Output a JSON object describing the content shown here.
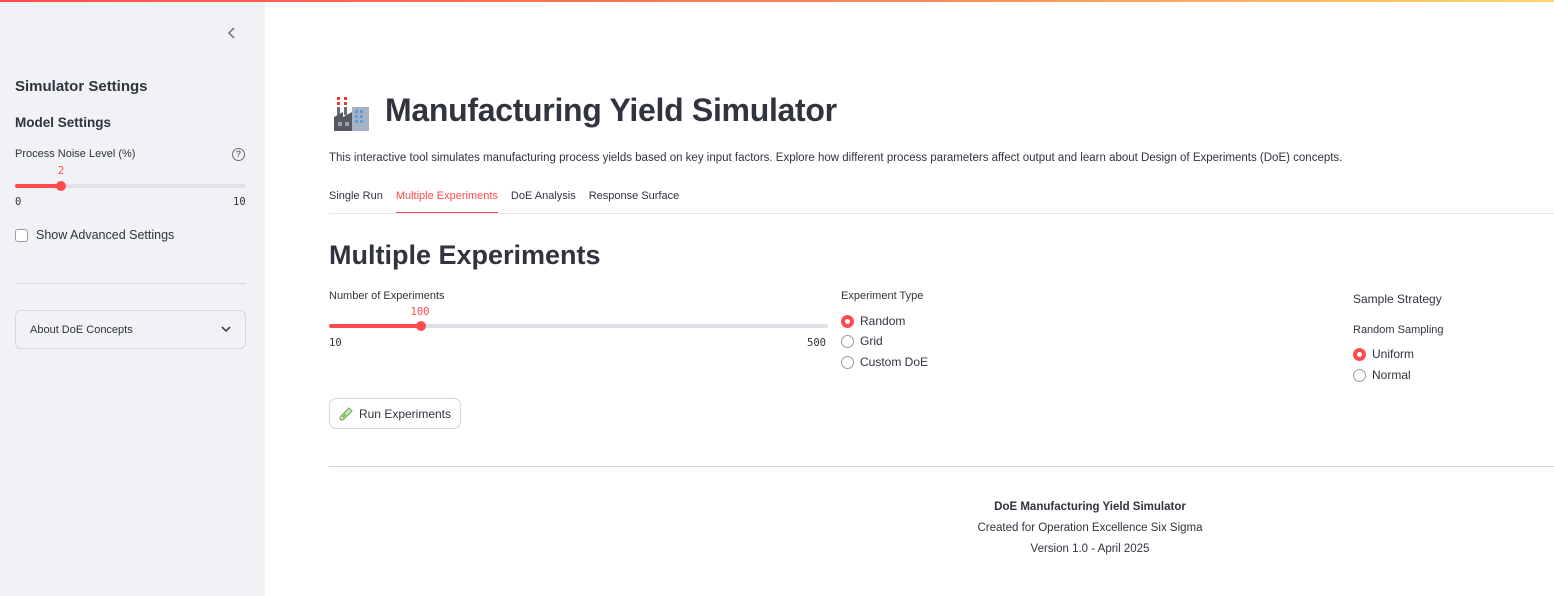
{
  "sidebar": {
    "collapse_icon": "chevron-left-icon",
    "title": "Simulator Settings",
    "model_settings": "Model Settings",
    "noise": {
      "label": "Process Noise Level (%)",
      "value": "2",
      "min": "0",
      "max": "10",
      "fraction": 0.2
    },
    "advanced_checkbox": {
      "label": "Show Advanced Settings",
      "checked": false
    },
    "expander": {
      "label": "About DoE Concepts",
      "icon": "chevron-down-icon"
    }
  },
  "header": {
    "icon": "factory-icon",
    "title": "Manufacturing Yield Simulator",
    "intro": "This interactive tool simulates manufacturing process yields based on key input factors. Explore how different process parameters affect output and learn about Design of Experiments (DoE) concepts."
  },
  "tabs": [
    {
      "label": "Single Run",
      "active": false
    },
    {
      "label": "Multiple Experiments",
      "active": true
    },
    {
      "label": "DoE Analysis",
      "active": false
    },
    {
      "label": "Response Surface",
      "active": false
    }
  ],
  "section": {
    "title": "Multiple Experiments",
    "num_experiments": {
      "label": "Number of Experiments",
      "value": "100",
      "min": "10",
      "max": "500",
      "fraction": 0.1837
    },
    "experiment_type": {
      "label": "Experiment Type",
      "options": [
        "Random",
        "Grid",
        "Custom DoE"
      ],
      "selected": "Random"
    },
    "sample_strategy": {
      "label": "Sample Strategy",
      "sublabel": "Random Sampling",
      "options": [
        "Uniform",
        "Normal"
      ],
      "selected": "Uniform"
    },
    "run_button": {
      "label": "Run Experiments",
      "icon": "test-tube-icon"
    }
  },
  "footer": {
    "title": "DoE Manufacturing Yield Simulator",
    "line2": "Created for Operation Excellence Six Sigma",
    "line3": "Version 1.0 - April 2025"
  },
  "colors": {
    "accent": "#ff4b4b",
    "sidebar_bg": "#f0f2f6",
    "text": "#31333f"
  }
}
